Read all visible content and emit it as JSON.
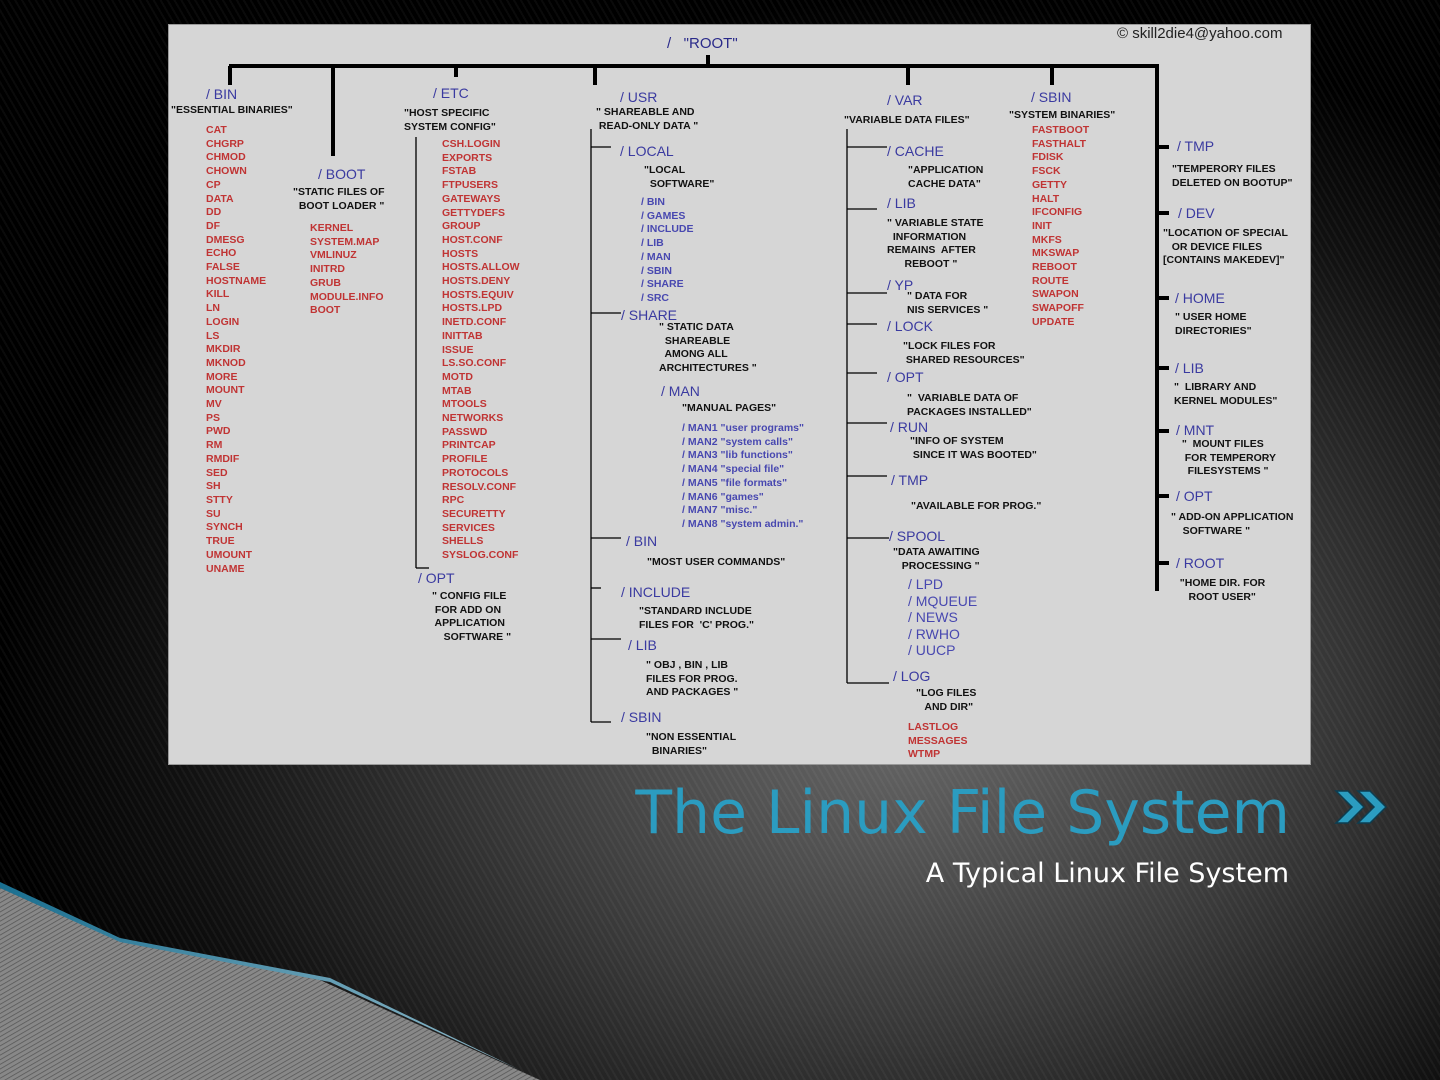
{
  "slide": {
    "title": "The Linux File System",
    "subtitle": "A Typical Linux File System",
    "accent_color": "#2b9cc0",
    "nav_icon": "double-chevron-right-icon"
  },
  "diagram": {
    "root": "/   \"ROOT\"",
    "copyright": "© skill2die4@yahoo.com",
    "bin": {
      "label": "/ BIN",
      "desc": "\"ESSENTIAL BINARIES\"",
      "items": [
        "CAT",
        "CHGRP",
        "CHMOD",
        "CHOWN",
        "CP",
        "DATA",
        "DD",
        "DF",
        "DMESG",
        "ECHO",
        "FALSE",
        "HOSTNAME",
        "KILL",
        "LN",
        "LOGIN",
        "LS",
        "MKDIR",
        "MKNOD",
        "MORE",
        "MOUNT",
        "MV",
        "PS",
        "PWD",
        "RM",
        "RMDIF",
        "SED",
        "SH",
        "STTY",
        "SU",
        "SYNCH",
        "TRUE",
        "UMOUNT",
        "UNAME"
      ]
    },
    "boot": {
      "label": "/ BOOT",
      "desc": "\"STATIC FILES OF\n  BOOT LOADER \"",
      "items": [
        "KERNEL",
        "SYSTEM.MAP",
        "VMLINUZ",
        "INITRD",
        "GRUB",
        "MODULE.INFO",
        "BOOT"
      ]
    },
    "etc": {
      "label": "/ ETC",
      "desc": "\"HOST SPECIFIC\nSYSTEM CONFIG\"",
      "items": [
        "CSH.LOGIN",
        "EXPORTS",
        "FSTAB",
        "FTPUSERS",
        "GATEWAYS",
        "GETTYDEFS",
        "GROUP",
        "HOST.CONF",
        "HOSTS",
        "HOSTS.ALLOW",
        "HOSTS.DENY",
        "HOSTS.EQUIV",
        "HOSTS.LPD",
        "INETD.CONF",
        "INITTAB",
        "ISSUE",
        "LS.SO.CONF",
        "MOTD",
        "MTAB",
        "MTOOLS",
        "NETWORKS",
        "PASSWD",
        "PRINTCAP",
        "PROFILE",
        "PROTOCOLS",
        "RESOLV.CONF",
        "RPC",
        "SECURETTY",
        "SERVICES",
        "SHELLS",
        "SYSLOG.CONF"
      ],
      "opt": {
        "label": "/ OPT",
        "desc": "\" CONFIG FILE\n FOR ADD ON\n APPLICATION\n    SOFTWARE \""
      }
    },
    "usr": {
      "label": "/ USR",
      "desc": "\" SHAREABLE AND\n READ-ONLY DATA \"",
      "local": {
        "label": "/ LOCAL",
        "desc": "\"LOCAL\n  SOFTWARE\"",
        "items": [
          "/ BIN",
          "/ GAMES",
          "/ INCLUDE",
          "/ LIB",
          "/ MAN",
          "/ SBIN",
          "/ SHARE",
          "/ SRC"
        ]
      },
      "share": {
        "label": "/ SHARE",
        "desc": "\" STATIC DATA\n  SHAREABLE\n  AMONG ALL\nARCHITECTURES \""
      },
      "man": {
        "label": "/ MAN",
        "desc": "\"MANUAL PAGES\"",
        "items": [
          "/ MAN1 \"user programs\"",
          "/ MAN2 \"system calls\"",
          "/ MAN3 \"lib functions\"",
          "/ MAN4 \"special file\"",
          "/ MAN5 \"file formats\"",
          "/ MAN6 \"games\"",
          "/ MAN7 \"misc.\"",
          "/ MAN8 \"system admin.\""
        ]
      },
      "bin": {
        "label": "/ BIN",
        "desc": "\"MOST USER COMMANDS\""
      },
      "include": {
        "label": "/ INCLUDE",
        "desc": "\"STANDARD INCLUDE\nFILES FOR  'C' PROG.\""
      },
      "lib": {
        "label": "/ LIB",
        "desc": "\" OBJ , BIN , LIB\nFILES FOR PROG.\nAND PACKAGES \""
      },
      "sbin": {
        "label": "/ SBIN",
        "desc": "\"NON ESSENTIAL\n  BINARIES\""
      }
    },
    "var": {
      "label": "/ VAR",
      "desc": "\"VARIABLE DATA FILES\"",
      "cache": {
        "label": "/ CACHE",
        "desc": "\"APPLICATION\nCACHE DATA\""
      },
      "lib": {
        "label": "/ LIB",
        "desc": "\" VARIABLE STATE\n  INFORMATION\nREMAINS  AFTER\n      REBOOT \""
      },
      "yp": {
        "label": "/ YP",
        "desc": "\" DATA FOR\nNIS SERVICES \""
      },
      "lock": {
        "label": "/ LOCK",
        "desc": "\"LOCK FILES FOR\n SHARED RESOURCES\""
      },
      "opt": {
        "label": "/ OPT",
        "desc": "\"  VARIABLE DATA OF\nPACKAGES INSTALLED\""
      },
      "run": {
        "label": "/ RUN",
        "desc": "\"INFO OF SYSTEM\n SINCE IT WAS BOOTED\""
      },
      "tmp": {
        "label": "/ TMP",
        "desc": "\"AVAILABLE FOR PROG.\""
      },
      "spool": {
        "label": "/ SPOOL",
        "desc": "\"DATA AWAITING\n   PROCESSING \"",
        "items": [
          "/ LPD",
          "/ MQUEUE",
          "/ NEWS",
          "/ RWHO",
          "/ UUCP"
        ]
      },
      "log": {
        "label": "/ LOG",
        "desc": "\"LOG FILES\n   AND DIR\"",
        "items": [
          "LASTLOG",
          "MESSAGES",
          "WTMP"
        ]
      }
    },
    "sbin": {
      "label": "/ SBIN",
      "desc": "\"SYSTEM BINARIES\"",
      "items": [
        "FASTBOOT",
        "FASTHALT",
        "FDISK",
        "FSCK",
        "GETTY",
        "HALT",
        "IFCONFIG",
        "INIT",
        "MKFS",
        "MKSWAP",
        "REBOOT",
        "ROUTE",
        "SWAPON",
        "SWAPOFF",
        "UPDATE"
      ]
    },
    "right": [
      {
        "label": "/ TMP",
        "desc": "\"TEMPERORY FILES\nDELETED ON BOOTUP\""
      },
      {
        "label": "/ DEV",
        "desc": "\"LOCATION OF SPECIAL\n   OR DEVICE FILES\n[CONTAINS MAKEDEV]\""
      },
      {
        "label": "/ HOME",
        "desc": "\" USER HOME\nDIRECTORIES\""
      },
      {
        "label": "/ LIB",
        "desc": "\"  LIBRARY AND\nKERNEL MODULES\""
      },
      {
        "label": "/ MNT",
        "desc": "  \"  MOUNT FILES\n   FOR TEMPERORY\n    FILESYSTEMS \""
      },
      {
        "label": "/ OPT",
        "desc": "\" ADD-ON APPLICATION\n    SOFTWARE \""
      },
      {
        "label": "/ ROOT",
        "desc": "   \"HOME DIR. FOR\n      ROOT USER\""
      }
    ]
  }
}
